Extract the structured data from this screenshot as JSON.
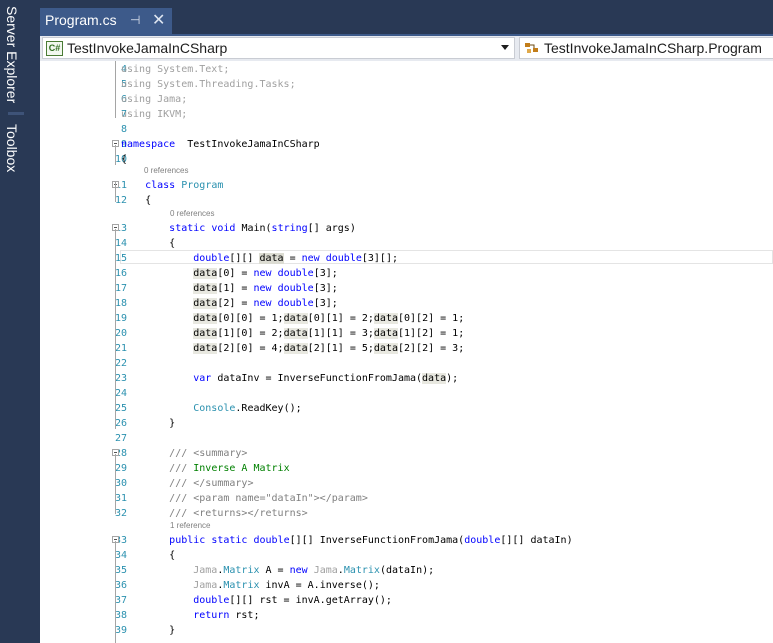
{
  "side_tabs": {
    "server_explorer": "Server Explorer",
    "toolbox": "Toolbox"
  },
  "tab": {
    "title": "Program.cs",
    "pin": "⊣",
    "close": "✕"
  },
  "nav": {
    "project": "TestInvokeJamaInCSharp",
    "project_icon": "C#",
    "class": "TestInvokeJamaInCSharp.Program"
  },
  "code_lens": {
    "class_refs": "0 references",
    "main_refs": "0 references",
    "inverse_refs": "1 reference"
  },
  "lines": [
    {
      "n": "4",
      "tokens": [
        [
          "dim",
          "using "
        ],
        [
          "dim",
          "System.Text;"
        ]
      ]
    },
    {
      "n": "5",
      "tokens": [
        [
          "dim",
          "using "
        ],
        [
          "dim",
          "System.Threading.Tasks;"
        ]
      ]
    },
    {
      "n": "6",
      "tokens": [
        [
          "dim",
          "using "
        ],
        [
          "dim",
          "Jama;"
        ]
      ]
    },
    {
      "n": "7",
      "tokens": [
        [
          "dim",
          "using "
        ],
        [
          "dim",
          "IKVM;"
        ]
      ]
    },
    {
      "n": "8",
      "tokens": []
    },
    {
      "n": "9",
      "tokens": [
        [
          "kw",
          "namespace"
        ],
        [
          "",
          "  TestInvokeJamaInCSharp"
        ]
      ]
    },
    {
      "n": "10",
      "tokens": [
        [
          "",
          "{"
        ]
      ]
    },
    {
      "n": "11",
      "tokens": [
        [
          "",
          "    "
        ],
        [
          "kw",
          "class"
        ],
        [
          "",
          " "
        ],
        [
          "ty",
          "Program"
        ]
      ]
    },
    {
      "n": "12",
      "tokens": [
        [
          "",
          "    {"
        ]
      ]
    },
    {
      "n": "13",
      "tokens": [
        [
          "",
          "        "
        ],
        [
          "kw",
          "static"
        ],
        [
          "",
          " "
        ],
        [
          "kw",
          "void"
        ],
        [
          "",
          " Main("
        ],
        [
          "kw",
          "string"
        ],
        [
          "",
          "[] args)"
        ]
      ]
    },
    {
      "n": "14",
      "tokens": [
        [
          "",
          "        {"
        ]
      ]
    },
    {
      "n": "15",
      "tokens": [
        [
          "",
          "            "
        ],
        [
          "kw",
          "double"
        ],
        [
          "",
          "[][] "
        ],
        [
          "sel",
          "data"
        ],
        [
          "",
          " = "
        ],
        [
          "kw",
          "new"
        ],
        [
          "",
          " "
        ],
        [
          "kw",
          "double"
        ],
        [
          "",
          "[3][];"
        ]
      ]
    },
    {
      "n": "16",
      "tokens": [
        [
          "",
          "            "
        ],
        [
          "hl",
          "data"
        ],
        [
          "",
          "[0] = "
        ],
        [
          "kw",
          "new"
        ],
        [
          "",
          " "
        ],
        [
          "kw",
          "double"
        ],
        [
          "",
          "[3];"
        ]
      ]
    },
    {
      "n": "17",
      "tokens": [
        [
          "",
          "            "
        ],
        [
          "hl",
          "data"
        ],
        [
          "",
          "[1] = "
        ],
        [
          "kw",
          "new"
        ],
        [
          "",
          " "
        ],
        [
          "kw",
          "double"
        ],
        [
          "",
          "[3];"
        ]
      ]
    },
    {
      "n": "18",
      "tokens": [
        [
          "",
          "            "
        ],
        [
          "hl",
          "data"
        ],
        [
          "",
          "[2] = "
        ],
        [
          "kw",
          "new"
        ],
        [
          "",
          " "
        ],
        [
          "kw",
          "double"
        ],
        [
          "",
          "[3];"
        ]
      ]
    },
    {
      "n": "19",
      "tokens": [
        [
          "",
          "            "
        ],
        [
          "hl",
          "data"
        ],
        [
          "",
          "[0][0] = 1;"
        ],
        [
          "hl",
          "data"
        ],
        [
          "",
          "[0][1] = 2;"
        ],
        [
          "hl",
          "data"
        ],
        [
          "",
          "[0][2] = 1;"
        ]
      ]
    },
    {
      "n": "20",
      "tokens": [
        [
          "",
          "            "
        ],
        [
          "hl",
          "data"
        ],
        [
          "",
          "[1][0] = 2;"
        ],
        [
          "hl",
          "data"
        ],
        [
          "",
          "[1][1] = 3;"
        ],
        [
          "hl",
          "data"
        ],
        [
          "",
          "[1][2] = 1;"
        ]
      ]
    },
    {
      "n": "21",
      "tokens": [
        [
          "",
          "            "
        ],
        [
          "hl",
          "data"
        ],
        [
          "",
          "[2][0] = 4;"
        ],
        [
          "hl",
          "data"
        ],
        [
          "",
          "[2][1] = 5;"
        ],
        [
          "hl",
          "data"
        ],
        [
          "",
          "[2][2] = 3;"
        ]
      ]
    },
    {
      "n": "22",
      "tokens": []
    },
    {
      "n": "23",
      "tokens": [
        [
          "",
          "            "
        ],
        [
          "kw",
          "var"
        ],
        [
          "",
          " dataInv = InverseFunctionFromJama("
        ],
        [
          "hl",
          "data"
        ],
        [
          "",
          ");"
        ]
      ]
    },
    {
      "n": "24",
      "tokens": []
    },
    {
      "n": "25",
      "tokens": [
        [
          "",
          "            "
        ],
        [
          "ty",
          "Console"
        ],
        [
          "",
          ".ReadKey();"
        ]
      ]
    },
    {
      "n": "26",
      "tokens": [
        [
          "",
          "        }"
        ]
      ]
    },
    {
      "n": "27",
      "tokens": []
    },
    {
      "n": "28",
      "tokens": [
        [
          "",
          "        "
        ],
        [
          "dc",
          "/// <summary>"
        ]
      ]
    },
    {
      "n": "29",
      "tokens": [
        [
          "",
          "        "
        ],
        [
          "dc",
          "/// "
        ],
        [
          "cm",
          "Inverse A Matrix"
        ]
      ]
    },
    {
      "n": "30",
      "tokens": [
        [
          "",
          "        "
        ],
        [
          "dc",
          "/// </summary>"
        ]
      ]
    },
    {
      "n": "31",
      "tokens": [
        [
          "",
          "        "
        ],
        [
          "dc",
          "/// <param name=\"dataIn\"></param>"
        ]
      ]
    },
    {
      "n": "32",
      "tokens": [
        [
          "",
          "        "
        ],
        [
          "dc",
          "/// <returns></returns>"
        ]
      ]
    },
    {
      "n": "33",
      "tokens": [
        [
          "",
          "        "
        ],
        [
          "kw",
          "public"
        ],
        [
          "",
          " "
        ],
        [
          "kw",
          "static"
        ],
        [
          "",
          " "
        ],
        [
          "kw",
          "double"
        ],
        [
          "",
          "[][] InverseFunctionFromJama("
        ],
        [
          "kw",
          "double"
        ],
        [
          "",
          "[][] dataIn)"
        ]
      ]
    },
    {
      "n": "34",
      "tokens": [
        [
          "",
          "        {"
        ]
      ]
    },
    {
      "n": "35",
      "tokens": [
        [
          "",
          "            "
        ],
        [
          "dim",
          "Jama"
        ],
        [
          "",
          "."
        ],
        [
          "ty",
          "Matrix"
        ],
        [
          "",
          " A = "
        ],
        [
          "kw",
          "new"
        ],
        [
          "",
          " "
        ],
        [
          "dim",
          "Jama"
        ],
        [
          "",
          "."
        ],
        [
          "ty",
          "Matrix"
        ],
        [
          "",
          "(dataIn);"
        ]
      ]
    },
    {
      "n": "36",
      "tokens": [
        [
          "",
          "            "
        ],
        [
          "dim",
          "Jama"
        ],
        [
          "",
          "."
        ],
        [
          "ty",
          "Matrix"
        ],
        [
          "",
          " invA = A.inverse();"
        ]
      ]
    },
    {
      "n": "37",
      "tokens": [
        [
          "",
          "            "
        ],
        [
          "kw",
          "double"
        ],
        [
          "",
          "[][] rst = invA.getArray();"
        ]
      ]
    },
    {
      "n": "38",
      "tokens": [
        [
          "",
          "            "
        ],
        [
          "kw",
          "return"
        ],
        [
          "",
          " rst;"
        ]
      ]
    },
    {
      "n": "39",
      "tokens": [
        [
          "",
          "        }"
        ]
      ]
    }
  ]
}
